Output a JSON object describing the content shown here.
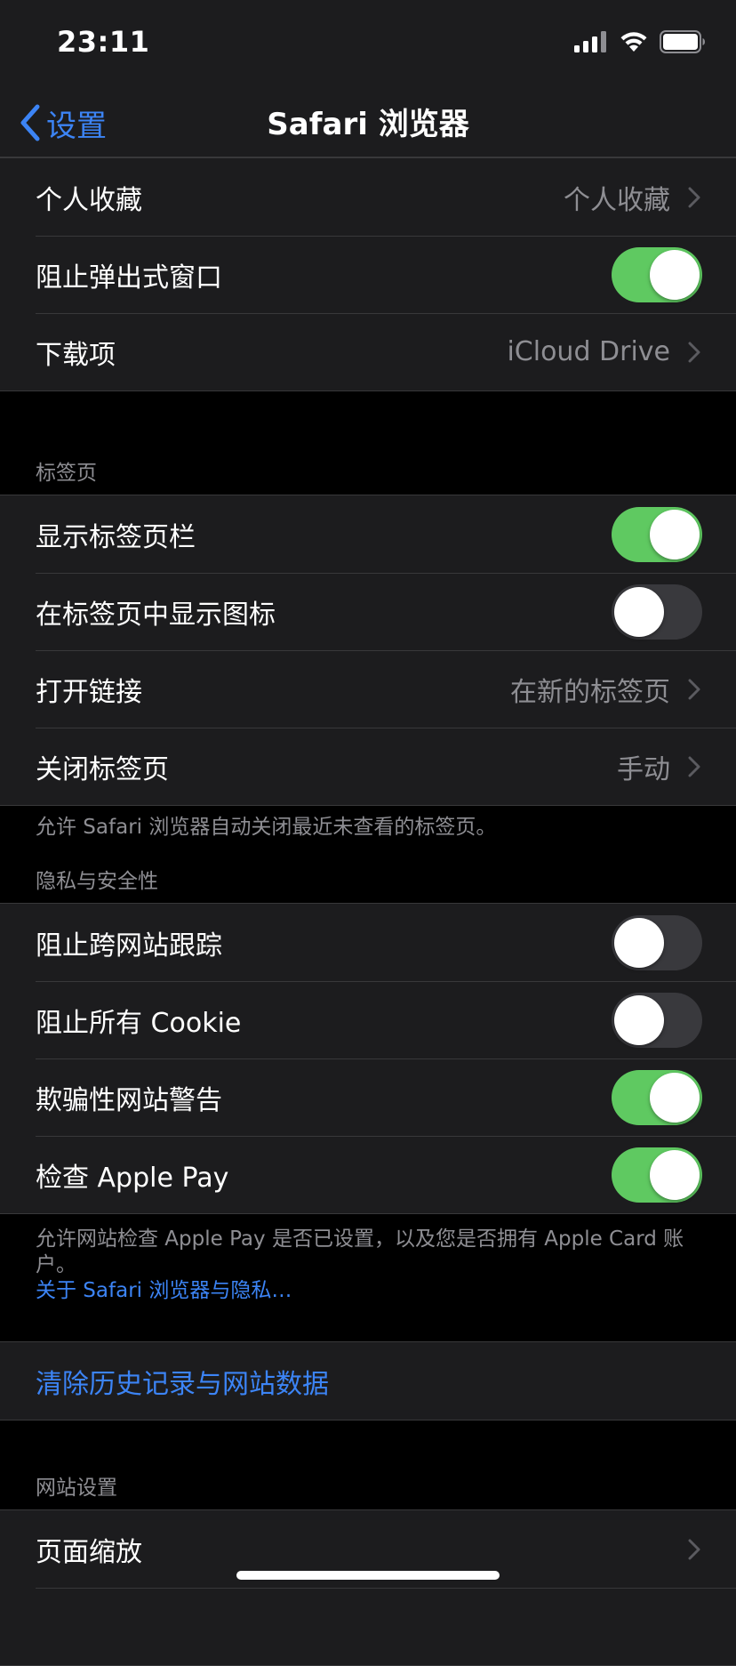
{
  "status_bar": {
    "time": "23:11"
  },
  "nav": {
    "back_label": "设置",
    "title": "Safari 浏览器"
  },
  "general": {
    "rows": [
      {
        "label": "个人收藏",
        "value": "个人收藏"
      },
      {
        "label": "阻止弹出式窗口",
        "toggle": true
      },
      {
        "label": "下载项",
        "value": "iCloud Drive"
      }
    ]
  },
  "tabs": {
    "header": "标签页",
    "rows": [
      {
        "label": "显示标签页栏",
        "toggle": true
      },
      {
        "label": "在标签页中显示图标",
        "toggle": false
      },
      {
        "label": "打开链接",
        "value": "在新的标签页"
      },
      {
        "label": "关闭标签页",
        "value": "手动"
      }
    ],
    "footer": "允许 Safari 浏览器自动关闭最近未查看的标签页。"
  },
  "privacy": {
    "header": "隐私与安全性",
    "rows": [
      {
        "label": "阻止跨网站跟踪",
        "toggle": false
      },
      {
        "label": "阻止所有 Cookie",
        "toggle": false
      },
      {
        "label": "欺骗性网站警告",
        "toggle": true
      },
      {
        "label": "检查 Apple Pay",
        "toggle": true
      }
    ],
    "footer": "允许网站检查 Apple Pay 是否已设置，以及您是否拥有 Apple Card 账户。",
    "footer_link": "关于 Safari 浏览器与隐私…"
  },
  "clear": {
    "label": "清除历史记录与网站数据"
  },
  "website": {
    "header": "网站设置",
    "rows": [
      {
        "label": "页面缩放"
      }
    ]
  },
  "colors": {
    "accent": "#3c84f5",
    "toggle_on": "#5fc961",
    "toggle_off": "#39393d",
    "cell_bg": "#1c1c1e",
    "page_bg": "#000000"
  }
}
